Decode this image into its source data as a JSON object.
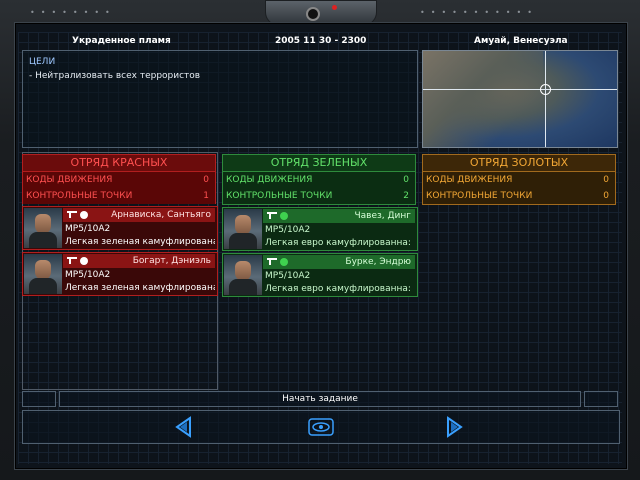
{
  "header": {
    "mission_name": "Украденное пламя",
    "datetime": "2005 11 30 - 2300",
    "location": "Амуай, Венесуэла"
  },
  "objectives": {
    "title": "ЦЕЛИ",
    "items": [
      "- Нейтрализовать всех террористов"
    ]
  },
  "teams": {
    "red": {
      "title": "ОТРЯД КРАСНЫХ",
      "move_codes_label": "КОДЫ ДВИЖЕНИЯ",
      "move_codes_value": "0",
      "waypoints_label": "КОНТРОЛЬНЫЕ ТОЧКИ",
      "waypoints_value": "1",
      "operatives": [
        {
          "name": "Арнависка, Сантьяго",
          "weapon": "MP5/10A2",
          "camo": "Легкая зеленая камуфлирована"
        },
        {
          "name": "Богарт, Дэниэль",
          "weapon": "MP5/10A2",
          "camo": "Легкая зеленая камуфлирована"
        }
      ]
    },
    "green": {
      "title": "ОТРЯД ЗЕЛЕНЫХ",
      "move_codes_label": "КОДЫ ДВИЖЕНИЯ",
      "move_codes_value": "0",
      "waypoints_label": "КОНТРОЛЬНЫЕ ТОЧКИ",
      "waypoints_value": "2",
      "operatives": [
        {
          "name": "Чавез, Динг",
          "weapon": "MP5/10A2",
          "camo": "Легкая евро камуфлированна:"
        },
        {
          "name": "Бурке, Эндрю",
          "weapon": "MP5/10A2",
          "camo": "Легкая евро камуфлированна:"
        }
      ]
    },
    "gold": {
      "title": "ОТРЯД ЗОЛОТЫХ",
      "move_codes_label": "КОДЫ ДВИЖЕНИЯ",
      "move_codes_value": "0",
      "waypoints_label": "КОНТРОЛЬНЫЕ ТОЧКИ",
      "waypoints_value": "0"
    }
  },
  "footer": {
    "start_label": "Начать задание"
  },
  "icons": {
    "back": "left-arrow-icon",
    "center": "eye-icon",
    "forward": "forward-arrow-icon"
  },
  "colors": {
    "red": "#ff5050",
    "green": "#62e16a",
    "gold": "#f2a735",
    "accent": "#3aa0ff"
  }
}
